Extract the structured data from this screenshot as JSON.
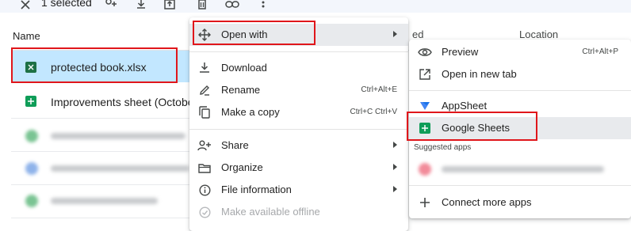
{
  "toolbar": {
    "close_icon": "close-icon",
    "selected_label": "1 selected",
    "actions": [
      "share-person-icon",
      "download-icon",
      "move-icon",
      "delete-icon",
      "link-icon",
      "more-vert-icon"
    ]
  },
  "list": {
    "columns": {
      "name": "Name",
      "modified_partial": "ed",
      "location": "Location"
    },
    "rows": [
      {
        "name": "protected book.xlsx",
        "icon": "excel-icon",
        "selected": true
      },
      {
        "name": "Improvements sheet (October",
        "icon": "sheets-icon",
        "selected": false
      },
      {
        "name": "",
        "icon": "blurred",
        "blurred": true
      },
      {
        "name": "",
        "icon": "blurred",
        "blurred": true
      },
      {
        "name": "",
        "icon": "blurred",
        "blurred": true
      }
    ]
  },
  "context_menu": {
    "open_with": {
      "label": "Open with",
      "icon": "open-with-icon"
    },
    "download": {
      "label": "Download",
      "icon": "download-icon"
    },
    "rename": {
      "label": "Rename",
      "shortcut": "Ctrl+Alt+E",
      "icon": "rename-icon"
    },
    "make_copy": {
      "label": "Make a copy",
      "shortcut": "Ctrl+C Ctrl+V",
      "icon": "copy-icon"
    },
    "share": {
      "label": "Share",
      "icon": "share-person-icon"
    },
    "organize": {
      "label": "Organize",
      "icon": "folder-icon"
    },
    "file_info": {
      "label": "File information",
      "icon": "info-icon"
    },
    "offline": {
      "label": "Make available offline",
      "icon": "offline-icon",
      "disabled": true
    }
  },
  "submenu": {
    "preview": {
      "label": "Preview",
      "shortcut": "Ctrl+Alt+P",
      "icon": "eye-icon"
    },
    "new_tab": {
      "label": "Open in new tab",
      "icon": "open-new-tab-icon"
    },
    "appsheet": {
      "label": "AppSheet",
      "icon": "appsheet-icon"
    },
    "google_sheets": {
      "label": "Google Sheets",
      "icon": "sheets-icon"
    },
    "suggested_header": "Suggested apps",
    "connect_more": {
      "label": "Connect more apps",
      "icon": "plus-icon"
    }
  },
  "colors": {
    "highlight_outline": "#e0161b",
    "selected_row": "#c2e7ff",
    "sheets_green": "#0f9d58",
    "excel_green": "#1e7145"
  }
}
